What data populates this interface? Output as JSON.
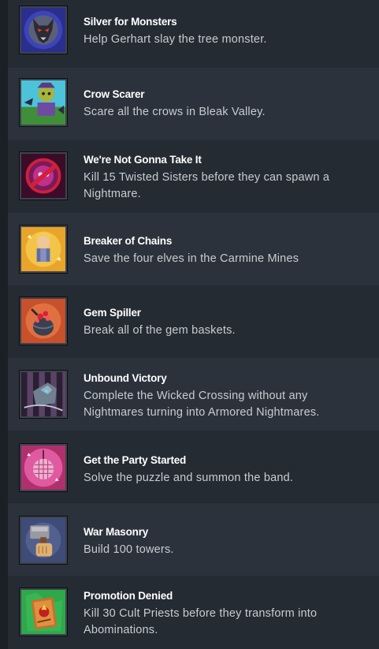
{
  "achievements": [
    {
      "title": "Silver for Monsters",
      "description": "Help Gerhart slay the tree monster.",
      "icon": "wolf-medallion-icon"
    },
    {
      "title": "Crow Scarer",
      "description": "Scare all the crows in Bleak Valley.",
      "icon": "scarecrow-icon"
    },
    {
      "title": "We're Not Gonna Take It",
      "description": "Kill 15 Twisted Sisters before they can spawn a Nightmare.",
      "icon": "twisted-sister-icon"
    },
    {
      "title": "Breaker of Chains",
      "description": "Save the four elves in the Carmine Mines",
      "icon": "elf-icon"
    },
    {
      "title": "Gem Spiller",
      "description": "Break all of the gem baskets.",
      "icon": "gem-basket-icon"
    },
    {
      "title": "Unbound Victory",
      "description": "Complete the Wicked Crossing without any Nightmares turning into Armored Nightmares.",
      "icon": "armored-nightmare-icon"
    },
    {
      "title": "Get the Party Started",
      "description": "Solve the puzzle and summon the band.",
      "icon": "disco-ball-icon"
    },
    {
      "title": "War Masonry",
      "description": "Build 100 towers.",
      "icon": "hammer-fist-icon"
    },
    {
      "title": "Promotion Denied",
      "description": "Kill 30 Cult Priests before they transform into Abominations.",
      "icon": "cult-scroll-icon"
    }
  ]
}
